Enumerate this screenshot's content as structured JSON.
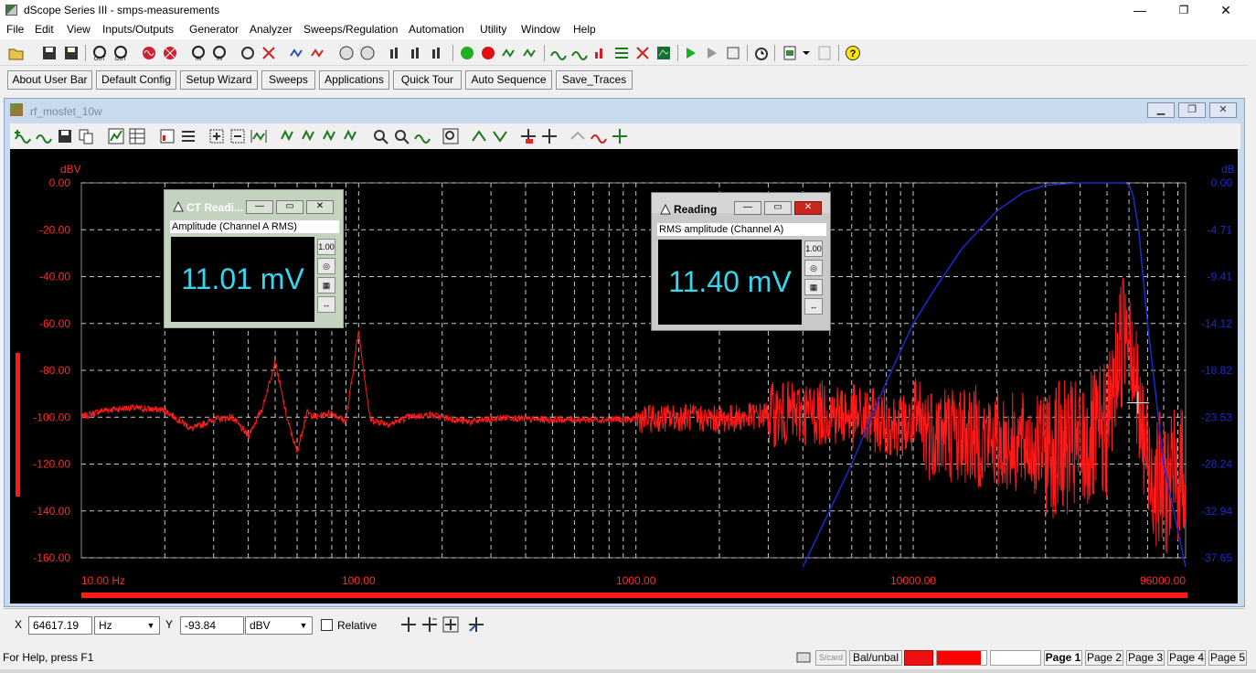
{
  "app": {
    "title": "dScope Series III - smps-measurements",
    "minimize": "—",
    "maximize": "❐",
    "close": "✕"
  },
  "menu": [
    "File",
    "Edit",
    "View",
    "Inputs/Outputs",
    "Generator",
    "Analyzer",
    "Sweeps/Regulation",
    "Automation",
    "Utility",
    "Window",
    "Help"
  ],
  "userbar": [
    "About User Bar",
    "Default Config",
    "Setup Wizard",
    "Sweeps",
    "Applications",
    "Quick Tour",
    "Auto Sequence",
    "Save_Traces"
  ],
  "graph_window": {
    "title": "rf_mosfet_10w"
  },
  "chart_data": {
    "type": "line",
    "xscale": "log",
    "xlim": [
      10,
      96000
    ],
    "x_ticks": [
      "10.00 Hz",
      "100.00",
      "1000.00",
      "10000.00",
      "96000.00"
    ],
    "left_axis": {
      "unit": "dBV",
      "ylim": [
        -170,
        0
      ],
      "ticks": [
        "0.00",
        "-20.00",
        "-40.00",
        "-60.00",
        "-80.00",
        "-100.00",
        "-120.00",
        "-140.00",
        "-160.00"
      ],
      "color": "#ff0000"
    },
    "right_axis": {
      "unit": "dB",
      "ticks": [
        "0.00",
        "-4.71",
        "-9.41",
        "-14.12",
        "-18.82",
        "-23.53",
        "-28.24",
        "-32.94",
        "-37.65"
      ],
      "color": "#1a2bd0"
    },
    "grid": true,
    "series": [
      {
        "color": "#ff1a1a",
        "x": [
          10,
          12,
          15,
          20,
          25,
          30,
          35,
          40,
          45,
          50,
          55,
          60,
          65,
          70,
          80,
          90,
          100,
          110,
          130,
          150,
          180,
          200,
          250,
          300,
          350,
          400,
          500,
          700,
          1000,
          1500,
          2000,
          3000,
          5000,
          7000,
          10000,
          15000,
          20000,
          30000,
          40000,
          50000,
          55000,
          60000,
          65000,
          70000,
          80000,
          96000
        ],
        "y": [
          -100,
          -97,
          -96,
          -97,
          -105,
          -101,
          -100,
          -108,
          -96,
          -76,
          -100,
          -115,
          -98,
          -100,
          -98,
          -102,
          -63,
          -101,
          -103,
          -100,
          -99,
          -100,
          -102,
          -101,
          -100,
          -101,
          -101,
          -101,
          -101,
          -100,
          -101,
          -99,
          -98,
          -101,
          -104,
          -107,
          -110,
          -113,
          -114,
          -106,
          -74,
          -52,
          -100,
          -120,
          -130,
          -122
        ]
      },
      {
        "color": "#1a2bd0",
        "x": [
          4000,
          6000,
          8000,
          10000,
          12000,
          15000,
          20000,
          25000,
          30000,
          40000,
          50000,
          55000,
          58000,
          60000,
          62000,
          65000,
          70000,
          80000,
          96000
        ],
        "y": [
          -170,
          -120,
          -85,
          -60,
          -45,
          -28,
          -12,
          -4,
          -1,
          0,
          0,
          0,
          0,
          -1,
          -5,
          -20,
          -60,
          -120,
          -170
        ]
      }
    ],
    "cursor": {
      "x": 64617.19,
      "y": -93.84
    }
  },
  "readings": [
    {
      "title": "CT Readi...",
      "label": "Amplitude (Channel A RMS)",
      "value": "11.01 mV"
    },
    {
      "title": "Reading",
      "label": "RMS amplitude (Channel A)",
      "value": "11.40 mV"
    }
  ],
  "cursor_bar": {
    "x_label": "X",
    "x_value": "64617.19",
    "x_unit": "Hz",
    "y_label": "Y",
    "y_value": "-93.84",
    "y_unit": "dBV",
    "relative_label": "Relative"
  },
  "status": {
    "help": "For Help, press F1",
    "scard": "S/card",
    "balunbal": "Bal/unbal",
    "pages": [
      "Page 1",
      "Page 2",
      "Page 3",
      "Page 4",
      "Page 5"
    ]
  }
}
